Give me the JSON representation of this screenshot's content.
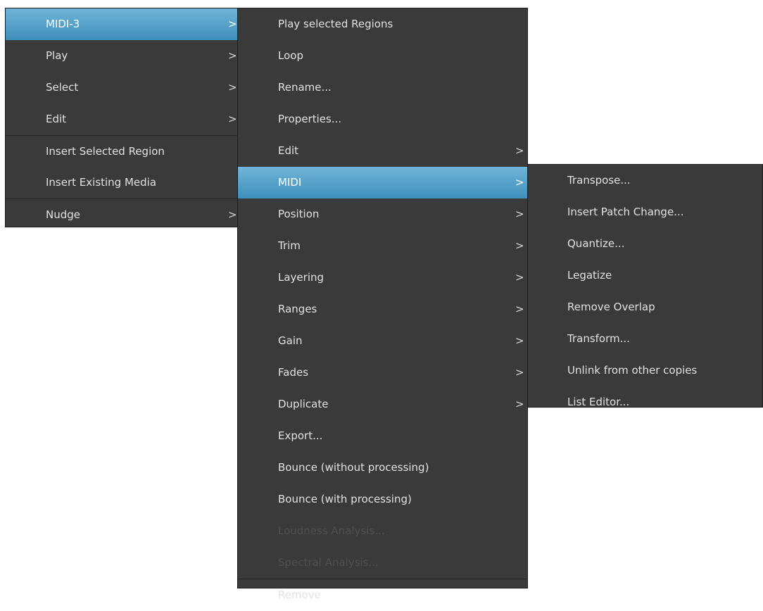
{
  "menu1": {
    "items": [
      {
        "label": "MIDI-3",
        "submenu": true,
        "selected": true
      },
      {
        "label": "Play",
        "submenu": true
      },
      {
        "label": "Select",
        "submenu": true
      },
      {
        "label": "Edit",
        "submenu": true
      },
      {
        "label": "Insert Selected Region",
        "submenu": false
      },
      {
        "label": "Insert Existing Media",
        "submenu": false
      },
      {
        "label": "Nudge",
        "submenu": true
      }
    ]
  },
  "menu2": {
    "items": [
      {
        "label": "Play selected Regions"
      },
      {
        "label": "Loop"
      },
      {
        "label": "Rename..."
      },
      {
        "label": "Properties..."
      },
      {
        "label": "Edit",
        "submenu": true
      },
      {
        "label": "MIDI",
        "submenu": true,
        "selected": true
      },
      {
        "label": "Position",
        "submenu": true
      },
      {
        "label": "Trim",
        "submenu": true
      },
      {
        "label": "Layering",
        "submenu": true
      },
      {
        "label": "Ranges",
        "submenu": true
      },
      {
        "label": "Gain",
        "submenu": true
      },
      {
        "label": "Fades",
        "submenu": true
      },
      {
        "label": "Duplicate",
        "submenu": true
      },
      {
        "label": "Export..."
      },
      {
        "label": "Bounce (without processing)"
      },
      {
        "label": "Bounce (with processing)"
      },
      {
        "label": "Loudness Analysis...",
        "disabled": true
      },
      {
        "label": "Spectral Analysis...",
        "disabled": true
      },
      {
        "label": "Remove"
      }
    ]
  },
  "menu3": {
    "items": [
      {
        "label": "Transpose..."
      },
      {
        "label": "Insert Patch Change..."
      },
      {
        "label": "Quantize..."
      },
      {
        "label": "Legatize"
      },
      {
        "label": "Remove Overlap"
      },
      {
        "label": "Transform..."
      },
      {
        "label": "Unlink from other copies"
      },
      {
        "label": "List Editor..."
      }
    ]
  },
  "arrow_glyph": ">",
  "colors": {
    "menu_bg": "#3a3a3a",
    "highlight_top": "#6fb5d8",
    "highlight_bottom": "#3f8fbb",
    "text": "#e2e2e2",
    "disabled_text": "#4f4f4f"
  }
}
